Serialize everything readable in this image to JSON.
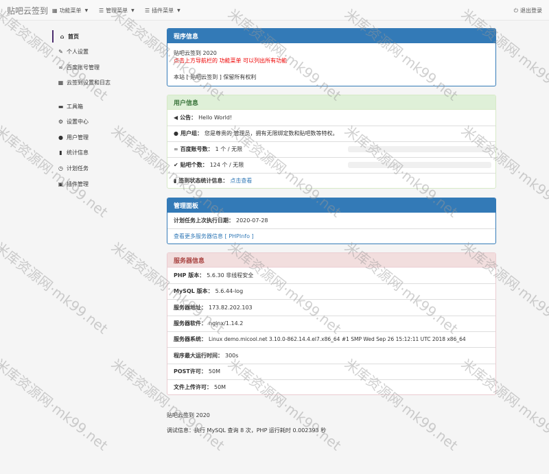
{
  "navbar": {
    "brand": "贴吧云签到",
    "menus": [
      {
        "label": "功能菜单",
        "icon": "grid-icon"
      },
      {
        "label": "管理菜单",
        "icon": "list-icon"
      },
      {
        "label": "插件菜单",
        "icon": "list-icon"
      }
    ],
    "logout": "退出登录"
  },
  "sidebar": {
    "items": [
      {
        "label": "首页",
        "icon": "home-icon",
        "active": true
      },
      {
        "label": "个人设置",
        "icon": "wrench-icon"
      },
      {
        "label": "百度账号管理",
        "icon": "link-icon"
      },
      {
        "label": "云签到设置和日志",
        "icon": "calendar-icon"
      },
      {
        "label": "工具箱",
        "icon": "briefcase-icon"
      },
      {
        "label": "设置中心",
        "icon": "gear-icon"
      },
      {
        "label": "用户管理",
        "icon": "user-icon"
      },
      {
        "label": "统计信息",
        "icon": "bar-chart-icon"
      },
      {
        "label": "计划任务",
        "icon": "clock-icon"
      },
      {
        "label": "插件管理",
        "icon": "plugin-icon"
      }
    ]
  },
  "program": {
    "title": "程序信息",
    "name": "贴吧云签到 2020",
    "hint": "点击上方导航栏的 功能菜单 可以列出所有功能",
    "copyright": "本站 [ 贴吧云签到 ] 保留所有权利"
  },
  "user": {
    "title": "用户信息",
    "notice_label": "公告：",
    "notice_value": "Hello World!",
    "group_label": "用户组：",
    "group_value": "您是尊贵的 管理员，拥有无限绑定数和贴吧数等特权。",
    "baidu_label": "百度账号数：",
    "baidu_value": "1 个 / 无限",
    "baidu_progress": 0,
    "tieba_label": "贴吧个数：",
    "tieba_value": "124 个 / 无限",
    "tieba_progress": 0,
    "stats_label": "签到状态统计信息：",
    "stats_link": "点击查看"
  },
  "admin": {
    "title": "管理面板",
    "cron_label": "计划任务上次执行日期：",
    "cron_value": "2020-07-28",
    "more_link": "查看更多服务器信息 [ PHPInfo ]"
  },
  "server": {
    "title": "服务器信息",
    "rows": [
      {
        "label": "PHP 版本：",
        "value": "5.6.30 非线程安全"
      },
      {
        "label": "MySQL 版本：",
        "value": "5.6.44-log"
      },
      {
        "label": "服务器地址：",
        "value": "173.82.202.103"
      },
      {
        "label": "服务器软件：",
        "value": "nginx/1.14.2"
      },
      {
        "label": "服务器系统：",
        "value": "Linux demo.micool.net 3.10.0-862.14.4.el7.x86_64 #1 SMP Wed Sep 26 15:12:11 UTC 2018 x86_64"
      },
      {
        "label": "程序最大运行时间：",
        "value": "300s"
      },
      {
        "label": "POST许可：",
        "value": "50M"
      },
      {
        "label": "文件上传许可：",
        "value": "50M"
      }
    ]
  },
  "footer": {
    "copyright": "贴吧云签到 2020",
    "debug": "调试信息：执行 MySQL 查询 8 次，PHP 运行耗时 0.002393 秒"
  },
  "watermark": "米库资源网·mk99.net"
}
